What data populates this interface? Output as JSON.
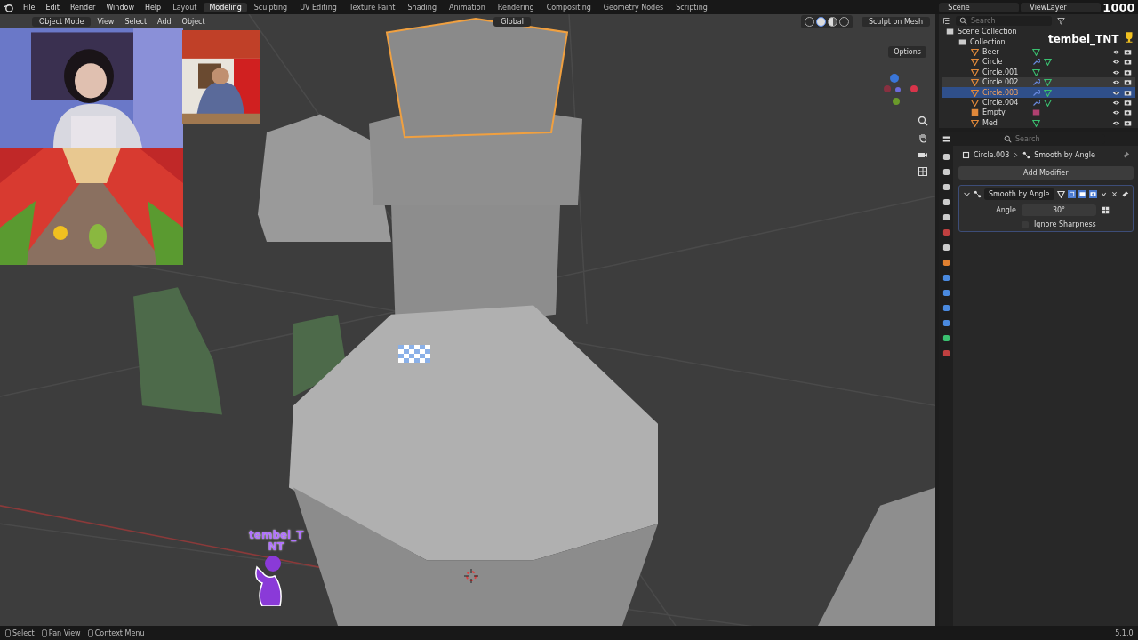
{
  "top_bar": {
    "menus": [
      "File",
      "Edit",
      "Render",
      "Window",
      "Help"
    ],
    "workspaces": [
      {
        "label": "Layout",
        "selected": false
      },
      {
        "label": "Modeling",
        "selected": true
      },
      {
        "label": "Sculpting",
        "selected": false
      },
      {
        "label": "UV Editing",
        "selected": false
      },
      {
        "label": "Texture Paint",
        "selected": false
      },
      {
        "label": "Shading",
        "selected": false
      },
      {
        "label": "Animation",
        "selected": false
      },
      {
        "label": "Rendering",
        "selected": false
      },
      {
        "label": "Compositing",
        "selected": false
      },
      {
        "label": "Geometry Nodes",
        "selected": false
      },
      {
        "label": "Scripting",
        "selected": false
      }
    ],
    "scene": "Scene",
    "view_layer": "ViewLayer"
  },
  "viewport_header": {
    "mode": "Object Mode",
    "menus": [
      "View",
      "Select",
      "Add",
      "Object"
    ],
    "orientation": "Global",
    "sculpt_button": "Sculpt on Mesh",
    "options": "Options"
  },
  "outliner": {
    "search_placeholder": "Search",
    "scene_collection": "Scene Collection",
    "collection": "Collection",
    "items": [
      {
        "name": "Beer",
        "kind": "mesh",
        "modifier": false,
        "selected": false,
        "hovered": false
      },
      {
        "name": "Circle",
        "kind": "mesh",
        "modifier": true,
        "selected": false,
        "hovered": false
      },
      {
        "name": "Circle.001",
        "kind": "mesh",
        "modifier": false,
        "selected": false,
        "hovered": false
      },
      {
        "name": "Circle.002",
        "kind": "mesh",
        "modifier": true,
        "selected": false,
        "hovered": true
      },
      {
        "name": "Circle.003",
        "kind": "mesh",
        "modifier": true,
        "selected": true,
        "hovered": false
      },
      {
        "name": "Circle.004",
        "kind": "mesh",
        "modifier": true,
        "selected": false,
        "hovered": false
      },
      {
        "name": "Empty",
        "kind": "empty",
        "modifier": false,
        "selected": false,
        "hovered": false
      },
      {
        "name": "Med",
        "kind": "mesh",
        "modifier": false,
        "selected": false,
        "hovered": false
      }
    ]
  },
  "properties": {
    "search_placeholder": "Search",
    "object": "Circle.003",
    "modifier_crumb": "Smooth by Angle",
    "add_modifier": "Add Modifier",
    "modifier": {
      "name": "Smooth by Angle",
      "expanded": true,
      "angle_label": "Angle",
      "angle_value": "30°",
      "ignore_sharpness": {
        "label": "Ignore Sharpness",
        "checked": false
      }
    }
  },
  "status_bar": {
    "hints": [
      "Select",
      "Pan View",
      "Context Menu"
    ],
    "version": "5.1.0"
  },
  "stream_overlay": {
    "channel": "tembel_TNT",
    "counter": "1000",
    "chat_user_lines": [
      "tembel_T",
      "NT"
    ]
  }
}
